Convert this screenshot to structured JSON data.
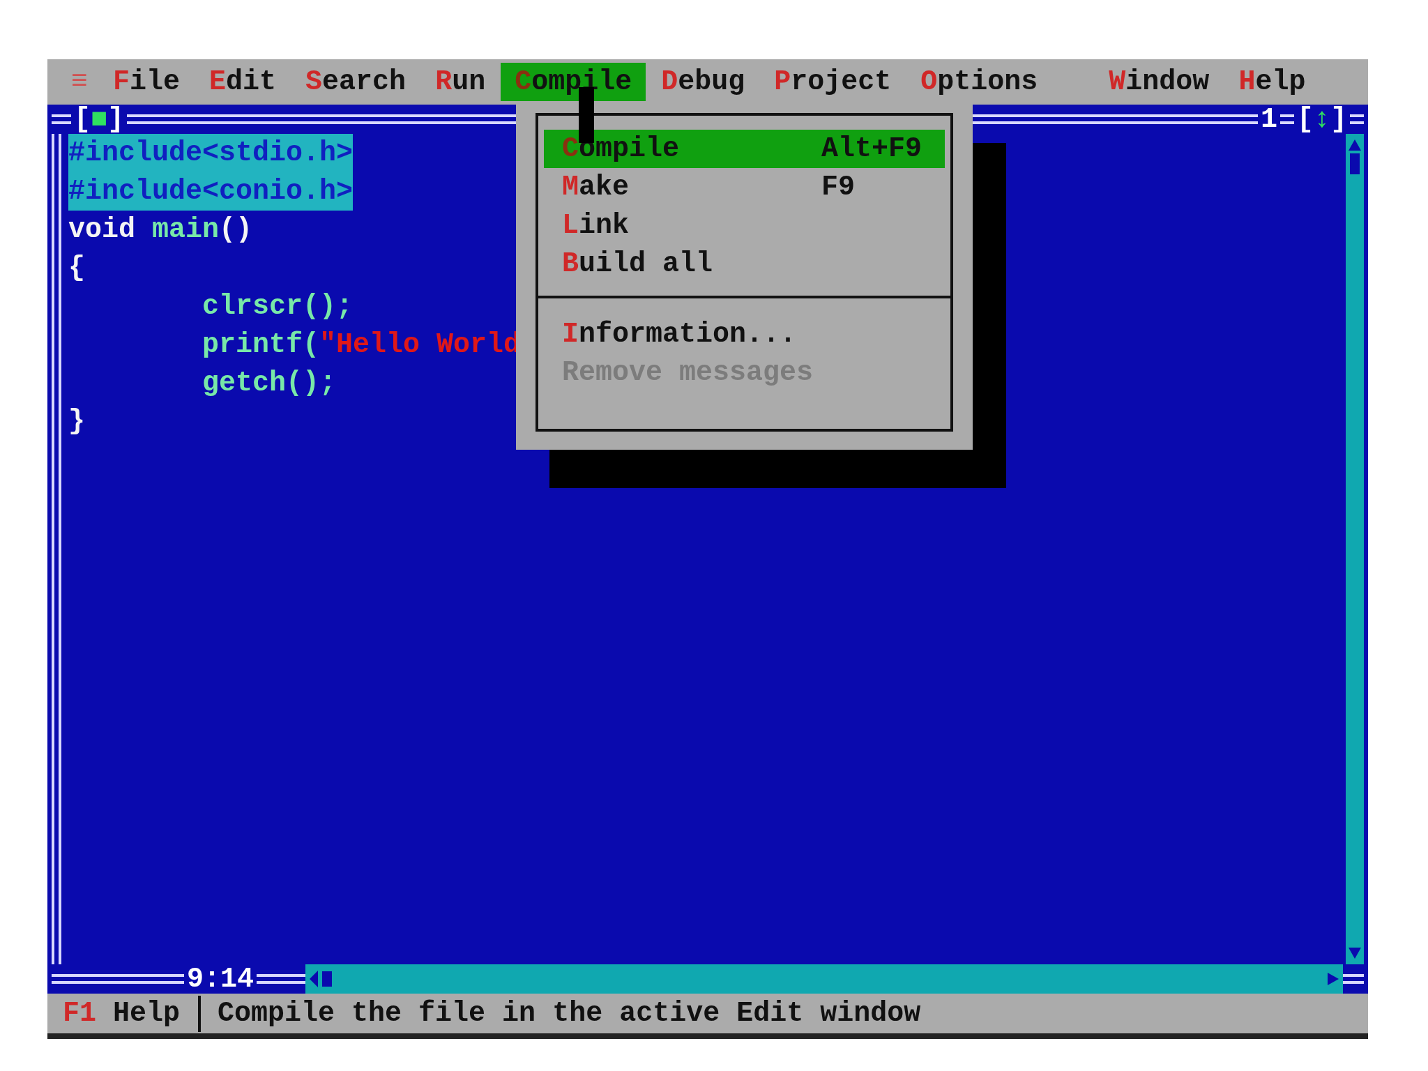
{
  "menu_bar": {
    "system": "≡",
    "items": [
      {
        "hotkey": "F",
        "rest": "ile",
        "selected": false
      },
      {
        "hotkey": "E",
        "rest": "dit",
        "selected": false
      },
      {
        "hotkey": "S",
        "rest": "earch",
        "selected": false
      },
      {
        "hotkey": "R",
        "rest": "un",
        "selected": false
      },
      {
        "hotkey": "C",
        "rest": "ompile",
        "selected": true
      },
      {
        "hotkey": "D",
        "rest": "ebug",
        "selected": false
      },
      {
        "hotkey": "P",
        "rest": "roject",
        "selected": false
      },
      {
        "hotkey": "O",
        "rest": "ptions",
        "selected": false
      },
      {
        "hotkey": "W",
        "rest": "indow",
        "selected": false
      },
      {
        "hotkey": "H",
        "rest": "elp",
        "selected": false
      }
    ]
  },
  "editor": {
    "close_box": "[■]",
    "number": "1",
    "zoom_box": "[↕]",
    "position": "9:14",
    "lines": [
      {
        "selected": true,
        "segments": [
          {
            "kind": "plain",
            "text": "#include<stdio.h>"
          }
        ]
      },
      {
        "selected": true,
        "segments": [
          {
            "kind": "plain",
            "text": "#include<conio.h>"
          }
        ]
      },
      {
        "selected": false,
        "segments": [
          {
            "kind": "keyword",
            "text": "void "
          },
          {
            "kind": "ident",
            "text": "main"
          },
          {
            "kind": "keyword",
            "text": "()"
          }
        ]
      },
      {
        "selected": false,
        "segments": [
          {
            "kind": "keyword",
            "text": "{"
          }
        ]
      },
      {
        "selected": false,
        "segments": [
          {
            "kind": "ident",
            "text": "        clrscr();"
          }
        ]
      },
      {
        "selected": false,
        "segments": [
          {
            "kind": "ident",
            "text": "        printf("
          },
          {
            "kind": "string",
            "text": "\"Hello World"
          }
        ]
      },
      {
        "selected": false,
        "segments": [
          {
            "kind": "ident",
            "text": "        getch();"
          }
        ]
      },
      {
        "selected": false,
        "segments": [
          {
            "kind": "keyword",
            "text": "}"
          }
        ]
      }
    ]
  },
  "compile_menu": {
    "groups": [
      [
        {
          "hotkey": "C",
          "rest": "ompile",
          "shortcut": "Alt+F9",
          "selected": true,
          "disabled": false
        },
        {
          "hotkey": "M",
          "rest": "ake",
          "shortcut": "F9",
          "selected": false,
          "disabled": false
        },
        {
          "hotkey": "L",
          "rest": "ink",
          "selected": false,
          "disabled": false
        },
        {
          "hotkey": "B",
          "rest": "uild all",
          "selected": false,
          "disabled": false
        }
      ],
      [
        {
          "hotkey": "I",
          "rest": "nformation...",
          "selected": false,
          "disabled": false
        },
        {
          "hotkey": "R",
          "rest": "emove messages",
          "selected": false,
          "disabled": true
        }
      ]
    ]
  },
  "status_bar": {
    "key": "F1",
    "key_label": "Help",
    "message": "Compile the file in the active Edit window"
  }
}
